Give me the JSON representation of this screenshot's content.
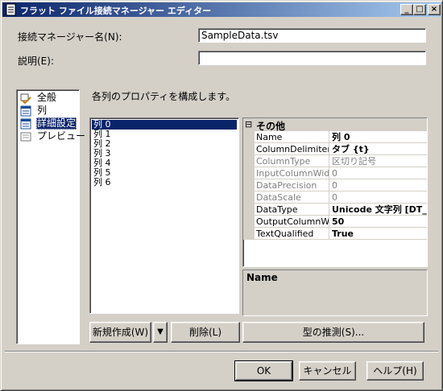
{
  "window": {
    "title": "フラット ファイル接続マネージャー エディター"
  },
  "titlebar": {
    "minimize": "_",
    "maximize": "□",
    "close": "×"
  },
  "form": {
    "conn_name_label": "接続マネージャー名(N):",
    "conn_name_value": "SampleData.tsv",
    "desc_label": "説明(E):",
    "desc_value": ""
  },
  "nav": {
    "items": [
      {
        "label": "全般",
        "icon": "general-page-icon"
      },
      {
        "label": "列",
        "icon": "columns-page-icon"
      },
      {
        "label": "詳細設定",
        "icon": "advanced-page-icon",
        "selected": true
      },
      {
        "label": "プレビュー",
        "icon": "preview-page-icon"
      }
    ]
  },
  "main": {
    "header": "各列のプロパティを構成します。",
    "columns": [
      "列 0",
      "列 1",
      "列 2",
      "列 3",
      "列 4",
      "列 5",
      "列 6"
    ],
    "selected_column": "列 0",
    "property_grid": {
      "category": "その他",
      "expander": "⊟",
      "rows": [
        {
          "name": "Name",
          "value": "列 0",
          "readonly": false,
          "bold": true
        },
        {
          "name": "ColumnDelimiter",
          "value": "タブ {t}",
          "readonly": false,
          "bold": true
        },
        {
          "name": "ColumnType",
          "value": "区切り記号",
          "readonly": true,
          "bold": false
        },
        {
          "name": "InputColumnWidth",
          "value": "0",
          "readonly": true,
          "bold": false
        },
        {
          "name": "DataPrecision",
          "value": "0",
          "readonly": true,
          "bold": false
        },
        {
          "name": "DataScale",
          "value": "0",
          "readonly": true,
          "bold": false
        },
        {
          "name": "DataType",
          "value": "Unicode 文字列 [DT_WSTR]",
          "readonly": false,
          "bold": true
        },
        {
          "name": "OutputColumnWidth",
          "value": "50",
          "readonly": false,
          "bold": true
        },
        {
          "name": "TextQualified",
          "value": "True",
          "readonly": false,
          "bold": true
        }
      ],
      "description_title": "Name"
    },
    "buttons": {
      "new": "新規作成(W)",
      "split_arrow": "▼",
      "delete": "削除(L)",
      "suggest": "型の推測(S)..."
    }
  },
  "footer": {
    "ok": "OK",
    "cancel": "キャンセル",
    "help": "ヘルプ(H)"
  },
  "colors": {
    "selection": "#0a246a",
    "face": "#d4d0c8"
  }
}
